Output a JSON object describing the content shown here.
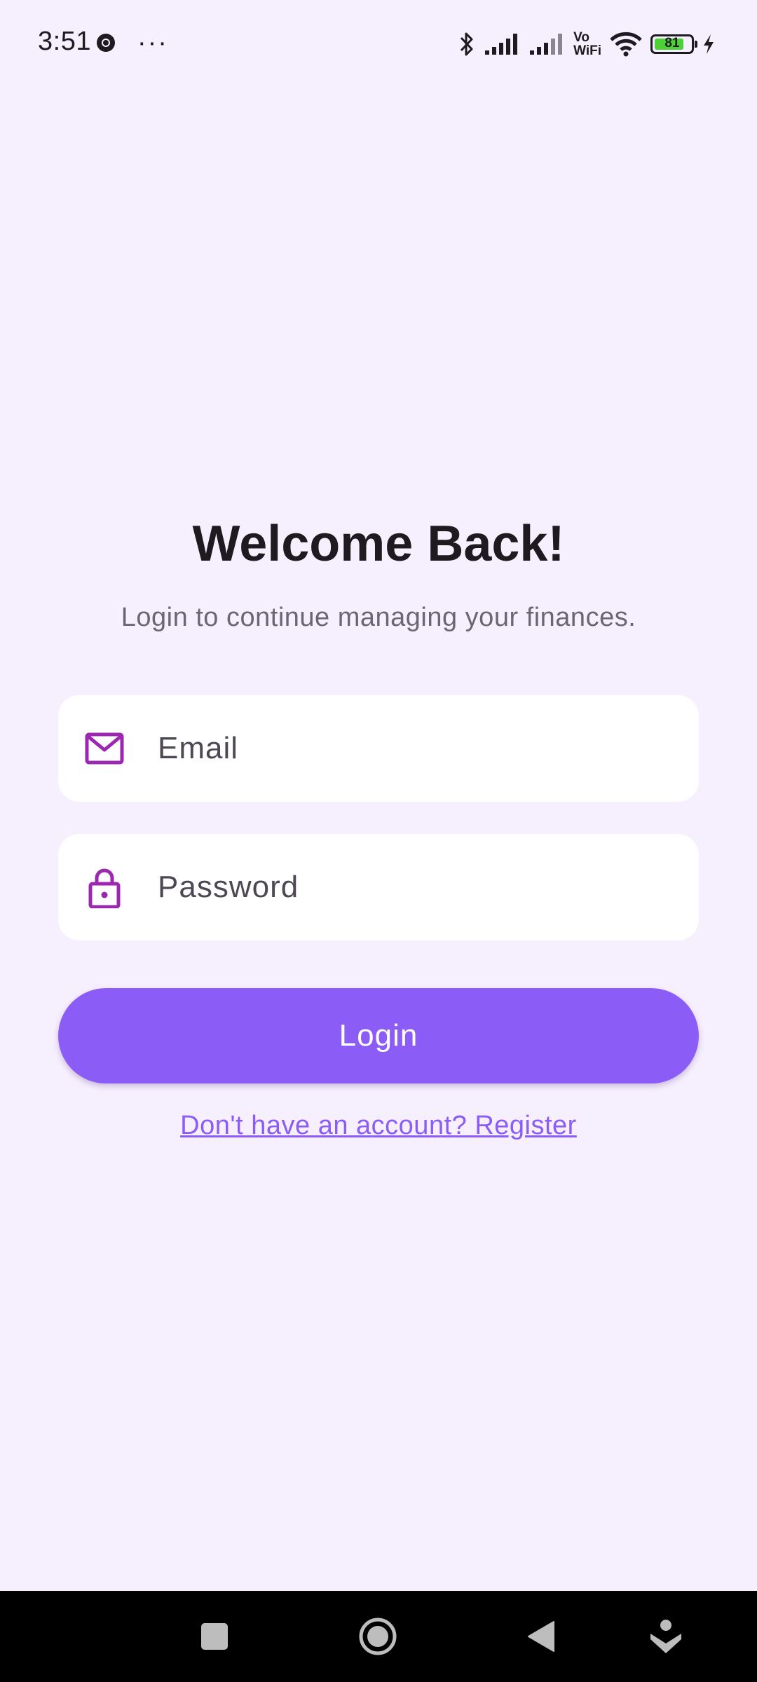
{
  "status_bar": {
    "time": "3:51",
    "dots": "···",
    "vowifi_line1": "Vo",
    "vowifi_line2": "WiFi",
    "battery_level": "81",
    "battery_fraction": 0.81,
    "icons": [
      "chrome-icon",
      "bluetooth-icon",
      "signal-icon",
      "signal-icon",
      "wifi-icon",
      "battery-icon",
      "charging-icon"
    ]
  },
  "header": {
    "title": "Welcome Back!",
    "subtitle": "Login to continue managing your finances."
  },
  "form": {
    "email": {
      "placeholder": "Email",
      "value": "",
      "icon": "mail-icon"
    },
    "password": {
      "placeholder": "Password",
      "value": "",
      "icon": "lock-icon"
    },
    "login_label": "Login",
    "register_link": "Don't have an account? Register"
  },
  "nav": {
    "icons": [
      "recents-icon",
      "home-icon",
      "back-icon",
      "assistant-icon"
    ]
  },
  "colors": {
    "background": "#f6effd",
    "accent": "#8b5cf6",
    "icon": "#9c27b0"
  }
}
